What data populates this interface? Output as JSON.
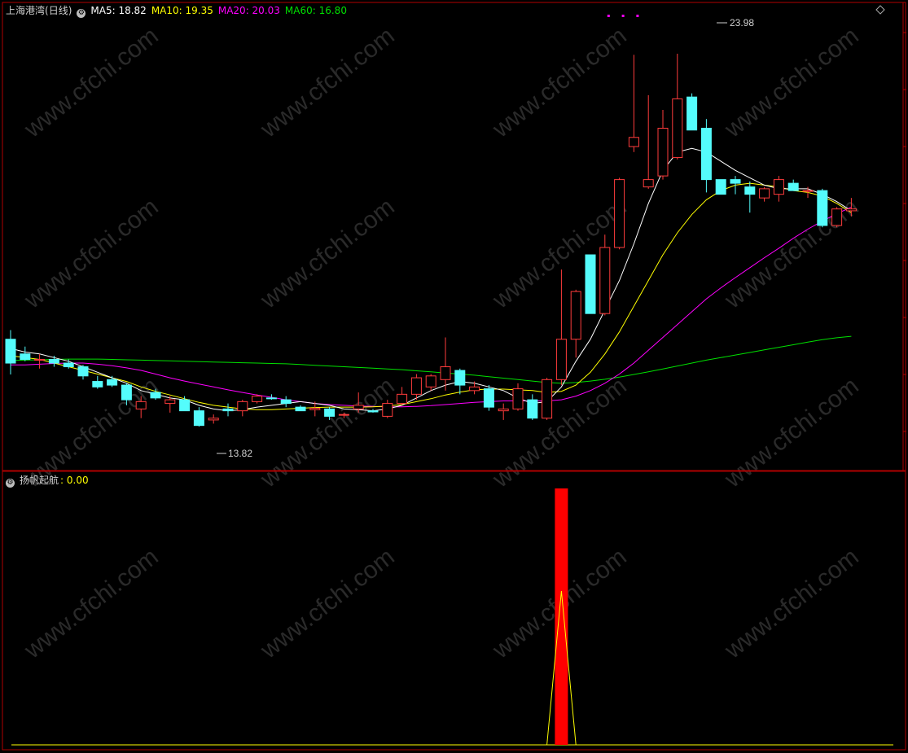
{
  "header": {
    "stock_name": "上海港湾",
    "period": "(日线)",
    "ma_items": [
      {
        "label": "MA5: 18.82",
        "color": "#ffffff"
      },
      {
        "label": "MA10: 19.35",
        "color": "#ffff00"
      },
      {
        "label": "MA20: 20.03",
        "color": "#ff00ff"
      },
      {
        "label": "MA60: 16.80",
        "color": "#00e000"
      }
    ]
  },
  "indicator": {
    "name": "扬帆起航",
    "value_label": ": 0.00"
  },
  "annotations": {
    "high_label": "23.98",
    "low_label": "13.82"
  },
  "watermark": "www.cfchi.com",
  "colors": {
    "up": "#ff3c3c",
    "down": "#54fcfc",
    "frame": "#b00000",
    "ma5": "#ffffff",
    "ma10": "#ffff00",
    "ma20": "#ff00ff",
    "ma60": "#00e000",
    "signal_bar": "#ff0000",
    "signal_line": "#ffff00"
  },
  "chart_data": {
    "type": "candlestick",
    "price_range": [
      12.8,
      25.0
    ],
    "candles": [
      {
        "o": 16.2,
        "h": 16.45,
        "l": 15.24,
        "c": 15.55
      },
      {
        "o": 15.8,
        "h": 16.0,
        "l": 15.6,
        "c": 15.65
      },
      {
        "o": 15.65,
        "h": 15.8,
        "l": 15.4,
        "c": 15.65
      },
      {
        "o": 15.65,
        "h": 15.75,
        "l": 15.45,
        "c": 15.55
      },
      {
        "o": 15.55,
        "h": 15.65,
        "l": 15.4,
        "c": 15.45
      },
      {
        "o": 15.45,
        "h": 15.5,
        "l": 15.1,
        "c": 15.2
      },
      {
        "o": 15.05,
        "h": 15.2,
        "l": 14.85,
        "c": 14.9
      },
      {
        "o": 15.1,
        "h": 15.2,
        "l": 14.9,
        "c": 14.95
      },
      {
        "o": 14.95,
        "h": 15.0,
        "l": 14.4,
        "c": 14.55
      },
      {
        "o": 14.3,
        "h": 14.65,
        "l": 14.05,
        "c": 14.5
      },
      {
        "o": 14.75,
        "h": 14.85,
        "l": 14.55,
        "c": 14.6
      },
      {
        "o": 14.45,
        "h": 14.65,
        "l": 14.2,
        "c": 14.55
      },
      {
        "o": 14.55,
        "h": 14.65,
        "l": 14.25,
        "c": 14.25
      },
      {
        "o": 14.25,
        "h": 14.35,
        "l": 13.82,
        "c": 13.85
      },
      {
        "o": 14.0,
        "h": 14.15,
        "l": 13.9,
        "c": 14.05
      },
      {
        "o": 14.3,
        "h": 14.45,
        "l": 14.1,
        "c": 14.25
      },
      {
        "o": 14.25,
        "h": 14.55,
        "l": 14.1,
        "c": 14.5
      },
      {
        "o": 14.5,
        "h": 14.7,
        "l": 14.45,
        "c": 14.65
      },
      {
        "o": 14.6,
        "h": 14.7,
        "l": 14.55,
        "c": 14.58
      },
      {
        "o": 14.55,
        "h": 14.65,
        "l": 14.35,
        "c": 14.45
      },
      {
        "o": 14.35,
        "h": 14.4,
        "l": 14.25,
        "c": 14.25
      },
      {
        "o": 14.28,
        "h": 14.5,
        "l": 14.1,
        "c": 14.32
      },
      {
        "o": 14.3,
        "h": 14.35,
        "l": 14.0,
        "c": 14.1
      },
      {
        "o": 14.15,
        "h": 14.2,
        "l": 14.05,
        "c": 14.15
      },
      {
        "o": 14.3,
        "h": 14.75,
        "l": 14.2,
        "c": 14.4
      },
      {
        "o": 14.25,
        "h": 14.3,
        "l": 14.2,
        "c": 14.22
      },
      {
        "o": 14.1,
        "h": 14.55,
        "l": 14.05,
        "c": 14.45
      },
      {
        "o": 14.45,
        "h": 14.9,
        "l": 14.4,
        "c": 14.7
      },
      {
        "o": 14.7,
        "h": 15.25,
        "l": 14.55,
        "c": 15.15
      },
      {
        "o": 14.9,
        "h": 15.25,
        "l": 14.8,
        "c": 15.2
      },
      {
        "o": 15.1,
        "h": 16.25,
        "l": 14.8,
        "c": 15.45
      },
      {
        "o": 15.35,
        "h": 15.4,
        "l": 14.7,
        "c": 14.95
      },
      {
        "o": 14.8,
        "h": 15.05,
        "l": 14.7,
        "c": 14.9
      },
      {
        "o": 14.85,
        "h": 14.95,
        "l": 14.25,
        "c": 14.35
      },
      {
        "o": 14.25,
        "h": 14.45,
        "l": 14.0,
        "c": 14.3
      },
      {
        "o": 14.3,
        "h": 15.0,
        "l": 14.25,
        "c": 14.85
      },
      {
        "o": 14.55,
        "h": 14.7,
        "l": 14.0,
        "c": 14.05
      },
      {
        "o": 14.05,
        "h": 15.15,
        "l": 14.0,
        "c": 15.1
      },
      {
        "o": 15.1,
        "h": 18.1,
        "l": 14.95,
        "c": 16.2
      },
      {
        "o": 16.2,
        "h": 17.55,
        "l": 15.7,
        "c": 17.5
      },
      {
        "o": 18.5,
        "h": 18.5,
        "l": 16.9,
        "c": 16.9
      },
      {
        "o": 16.9,
        "h": 19.05,
        "l": 16.85,
        "c": 18.7
      },
      {
        "o": 18.7,
        "h": 20.6,
        "l": 18.65,
        "c": 20.55
      },
      {
        "o": 21.45,
        "h": 23.95,
        "l": 21.3,
        "c": 21.7
      },
      {
        "o": 20.35,
        "h": 22.85,
        "l": 20.3,
        "c": 20.55
      },
      {
        "o": 20.65,
        "h": 22.45,
        "l": 20.55,
        "c": 21.95
      },
      {
        "o": 21.15,
        "h": 23.98,
        "l": 21.1,
        "c": 22.75
      },
      {
        "o": 22.8,
        "h": 22.9,
        "l": 21.9,
        "c": 21.9
      },
      {
        "o": 21.95,
        "h": 22.2,
        "l": 20.2,
        "c": 20.55
      },
      {
        "o": 20.55,
        "h": 20.55,
        "l": 20.15,
        "c": 20.15
      },
      {
        "o": 20.55,
        "h": 20.65,
        "l": 20.15,
        "c": 20.45
      },
      {
        "o": 20.35,
        "h": 20.5,
        "l": 19.65,
        "c": 20.15
      },
      {
        "o": 20.05,
        "h": 20.35,
        "l": 19.95,
        "c": 20.3
      },
      {
        "o": 20.15,
        "h": 20.65,
        "l": 19.95,
        "c": 20.55
      },
      {
        "o": 20.45,
        "h": 20.55,
        "l": 20.25,
        "c": 20.25
      },
      {
        "o": 20.25,
        "h": 20.35,
        "l": 20.05,
        "c": 20.25
      },
      {
        "o": 20.25,
        "h": 20.3,
        "l": 19.25,
        "c": 19.3
      },
      {
        "o": 19.3,
        "h": 19.8,
        "l": 19.25,
        "c": 19.75
      },
      {
        "o": 19.7,
        "h": 20.05,
        "l": 19.55,
        "c": 19.75
      }
    ],
    "ma5": [
      15.95,
      15.85,
      15.8,
      15.7,
      15.6,
      15.45,
      15.3,
      15.15,
      15.0,
      14.8,
      14.7,
      14.6,
      14.55,
      14.4,
      14.3,
      14.25,
      14.28,
      14.35,
      14.4,
      14.45,
      14.5,
      14.45,
      14.4,
      14.3,
      14.28,
      14.25,
      14.3,
      14.4,
      14.6,
      14.8,
      14.95,
      15.05,
      15.0,
      14.9,
      14.8,
      14.6,
      14.45,
      14.5,
      14.9,
      15.6,
      16.2,
      17.0,
      17.8,
      18.8,
      19.9,
      20.8,
      21.3,
      21.4,
      21.3,
      21.05,
      20.8,
      20.6,
      20.4,
      20.3,
      20.3,
      20.3,
      20.15,
      19.95,
      19.7
    ],
    "ma10": [
      15.75,
      15.7,
      15.65,
      15.55,
      15.45,
      15.35,
      15.25,
      15.15,
      15.05,
      14.9,
      14.78,
      14.68,
      14.58,
      14.48,
      14.4,
      14.35,
      14.3,
      14.28,
      14.28,
      14.3,
      14.32,
      14.34,
      14.35,
      14.35,
      14.35,
      14.36,
      14.38,
      14.42,
      14.5,
      14.58,
      14.68,
      14.76,
      14.82,
      14.84,
      14.84,
      14.82,
      14.8,
      14.75,
      14.78,
      14.95,
      15.3,
      15.8,
      16.4,
      17.1,
      17.8,
      18.5,
      19.1,
      19.6,
      20.0,
      20.25,
      20.4,
      20.45,
      20.4,
      20.35,
      20.25,
      20.2,
      20.1,
      19.9,
      19.65
    ],
    "ma20": [
      15.5,
      15.5,
      15.52,
      15.54,
      15.55,
      15.55,
      15.52,
      15.48,
      15.42,
      15.35,
      15.25,
      15.15,
      15.06,
      14.98,
      14.9,
      14.82,
      14.75,
      14.68,
      14.62,
      14.55,
      14.5,
      14.45,
      14.42,
      14.4,
      14.38,
      14.37,
      14.36,
      14.36,
      14.37,
      14.39,
      14.42,
      14.45,
      14.48,
      14.5,
      14.52,
      14.52,
      14.52,
      14.52,
      14.55,
      14.65,
      14.8,
      15.0,
      15.25,
      15.55,
      15.9,
      16.25,
      16.6,
      16.95,
      17.3,
      17.6,
      17.88,
      18.15,
      18.42,
      18.68,
      18.95,
      19.2,
      19.42,
      19.62,
      19.8
    ],
    "ma60": [
      15.62,
      15.63,
      15.64,
      15.65,
      15.66,
      15.66,
      15.66,
      15.65,
      15.64,
      15.63,
      15.62,
      15.61,
      15.6,
      15.59,
      15.58,
      15.57,
      15.56,
      15.55,
      15.54,
      15.53,
      15.51,
      15.49,
      15.47,
      15.45,
      15.43,
      15.41,
      15.39,
      15.37,
      15.34,
      15.31,
      15.28,
      15.25,
      15.22,
      15.18,
      15.14,
      15.1,
      15.06,
      15.02,
      15.0,
      15.02,
      15.06,
      15.11,
      15.17,
      15.24,
      15.31,
      15.39,
      15.47,
      15.55,
      15.63,
      15.7,
      15.77,
      15.84,
      15.91,
      15.98,
      16.05,
      16.12,
      16.19,
      16.24,
      16.28
    ],
    "signal_index": 38,
    "signal_range": [
      0,
      1
    ]
  }
}
